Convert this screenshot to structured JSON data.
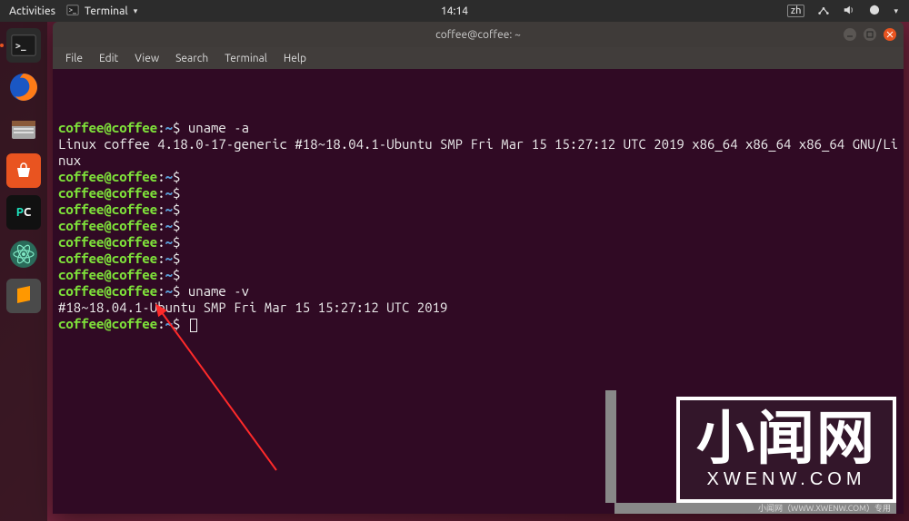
{
  "topbar": {
    "activities": "Activities",
    "app_name": "Terminal",
    "clock": "14:14"
  },
  "dock": {
    "items": [
      {
        "name": "terminal",
        "active": true
      },
      {
        "name": "firefox",
        "active": false
      },
      {
        "name": "files",
        "active": false
      },
      {
        "name": "software",
        "active": false
      },
      {
        "name": "pycharm",
        "active": false
      },
      {
        "name": "atom",
        "active": false
      },
      {
        "name": "sublime",
        "active": false
      }
    ]
  },
  "window": {
    "title": "coffee@coffee: ~",
    "menu": [
      "File",
      "Edit",
      "View",
      "Search",
      "Terminal",
      "Help"
    ]
  },
  "terminal": {
    "prompt_user_host": "coffee@coffee",
    "prompt_path": "~",
    "prompt_symbol": "$",
    "lines": [
      {
        "type": "cmd",
        "text": "uname -a"
      },
      {
        "type": "out",
        "text": "Linux coffee 4.18.0-17-generic #18~18.04.1-Ubuntu SMP Fri Mar 15 15:27:12 UTC 2019 x86_64 x86_64 x86_64 GNU/Linux"
      },
      {
        "type": "cmd",
        "text": ""
      },
      {
        "type": "cmd",
        "text": ""
      },
      {
        "type": "cmd",
        "text": ""
      },
      {
        "type": "cmd",
        "text": ""
      },
      {
        "type": "cmd",
        "text": ""
      },
      {
        "type": "cmd",
        "text": ""
      },
      {
        "type": "cmd",
        "text": ""
      },
      {
        "type": "cmd",
        "text": "uname -v"
      },
      {
        "type": "out",
        "text": "#18~18.04.1-Ubuntu SMP Fri Mar 15 15:27:12 UTC 2019"
      },
      {
        "type": "cmd",
        "text": "",
        "cursor": true
      }
    ]
  },
  "watermark": {
    "main": "小闻网",
    "sub": "XWENW.COM",
    "strip": "小闻网（WWW.XWENW.COM）专用"
  },
  "colors": {
    "accent": "#e95420",
    "terminal_bg": "#300a24",
    "prompt_green": "#7ee03a",
    "prompt_blue": "#5a9dd6"
  }
}
